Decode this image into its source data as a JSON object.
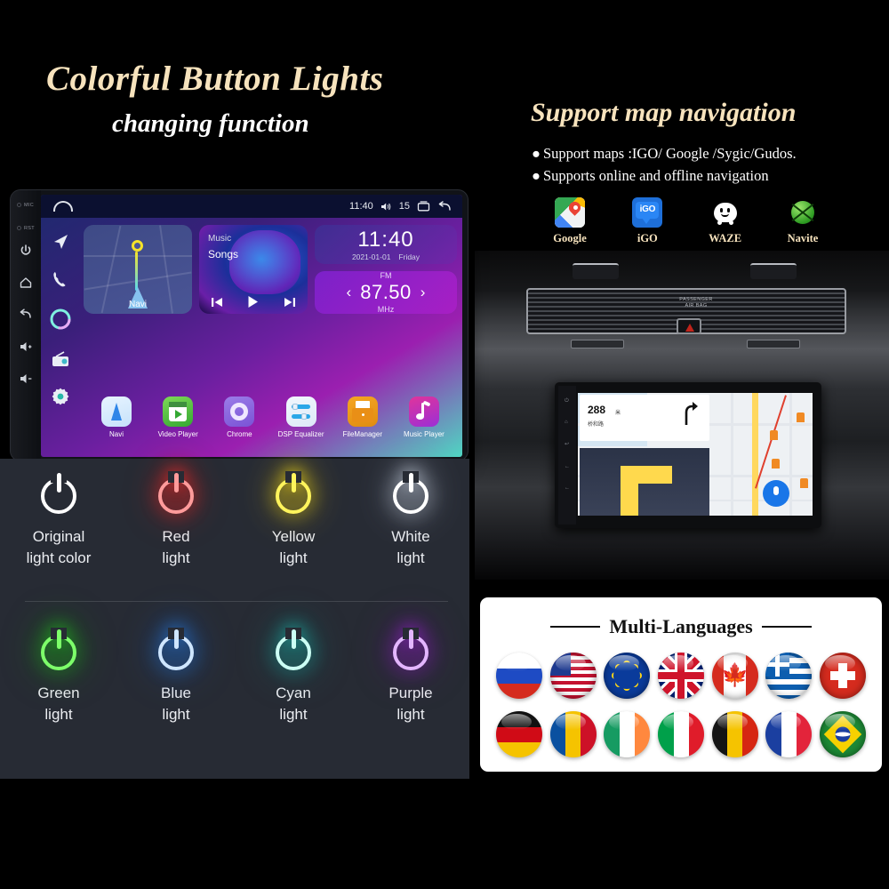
{
  "headings": {
    "left_title": "Colorful Button Lights",
    "left_subtitle": "changing function",
    "right_title": "Support map navigation"
  },
  "bullets": [
    "Support maps :IGO/ Google /Sygic/Gudos.",
    "Supports online and offline navigation"
  ],
  "nav_apps": [
    {
      "label": "Google",
      "icon": "google-maps-icon"
    },
    {
      "label": "iGO",
      "icon": "igo-icon"
    },
    {
      "label": "WAZE",
      "icon": "waze-icon"
    },
    {
      "label": "Navite",
      "icon": "navite-icon"
    }
  ],
  "head_unit": {
    "bezel": {
      "mic_label": "MIC",
      "rst_label": "RST",
      "buttons": [
        "power-icon",
        "home-icon",
        "back-icon",
        "volume-up-icon",
        "volume-down-icon"
      ]
    },
    "status_bar": {
      "home_icon": "home-icon",
      "time": "11:40",
      "volume_icon": "volume-icon",
      "volume_level": "15",
      "recents_icon": "recents-icon",
      "back_icon": "back-icon"
    },
    "sidebar_icons": [
      "navigation-arrow-icon",
      "phone-icon",
      "voice-circle-icon",
      "radio-icon",
      "settings-gear-icon"
    ],
    "widgets": {
      "navi": {
        "label": "Navi"
      },
      "music": {
        "title": "Music",
        "subtitle": "Songs",
        "controls": [
          "previous-track-icon",
          "play-icon",
          "next-track-icon"
        ]
      },
      "clock": {
        "time": "11:40",
        "date": "2021-01-01",
        "weekday": "Friday"
      },
      "radio": {
        "band": "FM",
        "frequency": "87.50",
        "unit": "MHz",
        "prev": "‹",
        "next": "›"
      }
    },
    "dock": [
      {
        "label": "Navi"
      },
      {
        "label": "Video Player"
      },
      {
        "label": "Chrome"
      },
      {
        "label": "DSP Equalizer"
      },
      {
        "label": "FileManager"
      },
      {
        "label": "Music Player"
      }
    ]
  },
  "light_panel": {
    "rows": [
      [
        {
          "name": "Original",
          "name2": "light color",
          "color": "#ffffff",
          "glow": "none"
        },
        {
          "name": "Red",
          "name2": "light",
          "color": "#ff9b9b",
          "glow": "#e03030"
        },
        {
          "name": "Yellow",
          "name2": "light",
          "color": "#fff45c",
          "glow": "#e8d21a"
        },
        {
          "name": "White",
          "name2": "light",
          "color": "#ffffff",
          "glow": "#c9d2e0"
        }
      ],
      [
        {
          "name": "Green",
          "name2": "light",
          "color": "#7dff6a",
          "glow": "#22c421"
        },
        {
          "name": "Blue",
          "name2": "light",
          "color": "#cfe6ff",
          "glow": "#2a7fe0"
        },
        {
          "name": "Cyan",
          "name2": "light",
          "color": "#ccfff4",
          "glow": "#1fb9b0"
        },
        {
          "name": "Purple",
          "name2": "light",
          "color": "#e3b6ff",
          "glow": "#9b25d6"
        }
      ]
    ]
  },
  "dashboard": {
    "airbag_label_line1": "PASSENGER",
    "airbag_label_line2": "AIR BAG",
    "hazard_button": "hazard-triangle-icon",
    "nav_screen": {
      "distance": "288",
      "distance_unit": "米",
      "road_name": "桥和路",
      "turn_icon": "turn-right-arrow-icon",
      "mic_button": "microphone-icon"
    }
  },
  "languages": {
    "title": "Multi-Languages",
    "rows": [
      [
        {
          "name": "Russia"
        },
        {
          "name": "USA"
        },
        {
          "name": "European Union"
        },
        {
          "name": "United Kingdom"
        },
        {
          "name": "Canada"
        },
        {
          "name": "Greece"
        },
        {
          "name": "Switzerland"
        }
      ],
      [
        {
          "name": "Germany"
        },
        {
          "name": "Romania"
        },
        {
          "name": "Ireland"
        },
        {
          "name": "Italy"
        },
        {
          "name": "Belgium"
        },
        {
          "name": "France"
        },
        {
          "name": "Brazil"
        }
      ]
    ]
  },
  "colors": {
    "heading_gold": "#f7e3bd",
    "panel_bg": "#272b34",
    "card_bg": "#ffffff"
  }
}
